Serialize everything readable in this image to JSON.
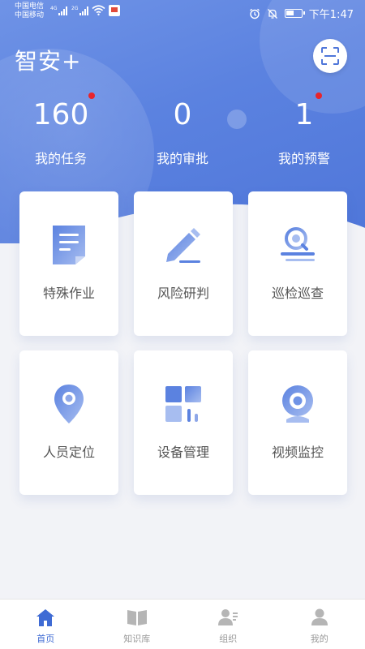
{
  "status_bar": {
    "carrier1": "中国电信",
    "carrier2": "中国移动",
    "net1": "4G",
    "net2": "2G",
    "time": "下午1:47"
  },
  "header": {
    "app_title": "智安+",
    "scan_icon": "scan-icon"
  },
  "stats": [
    {
      "value": "160",
      "label": "我的任务",
      "has_badge": true
    },
    {
      "value": "0",
      "label": "我的审批",
      "has_badge": false
    },
    {
      "value": "1",
      "label": "我的预警",
      "has_badge": true
    }
  ],
  "modules": [
    {
      "label": "特殊作业",
      "icon": "document-icon"
    },
    {
      "label": "风险研判",
      "icon": "pencil-icon"
    },
    {
      "label": "巡检巡查",
      "icon": "inspection-icon"
    },
    {
      "label": "人员定位",
      "icon": "location-pin-icon"
    },
    {
      "label": "设备管理",
      "icon": "device-grid-icon"
    },
    {
      "label": "视频监控",
      "icon": "camera-icon"
    }
  ],
  "bottom_nav": [
    {
      "label": "首页",
      "icon": "home-icon",
      "active": true
    },
    {
      "label": "知识库",
      "icon": "book-icon",
      "active": false
    },
    {
      "label": "组织",
      "icon": "organization-icon",
      "active": false
    },
    {
      "label": "我的",
      "icon": "profile-icon",
      "active": false
    }
  ],
  "colors": {
    "primary": "#5b82e0",
    "icon_gradient_start": "#5b82e0",
    "icon_gradient_end": "#a7bdf0",
    "badge": "#e8242b",
    "nav_active": "#3f6bd4",
    "nav_inactive": "#b5b5b5"
  }
}
